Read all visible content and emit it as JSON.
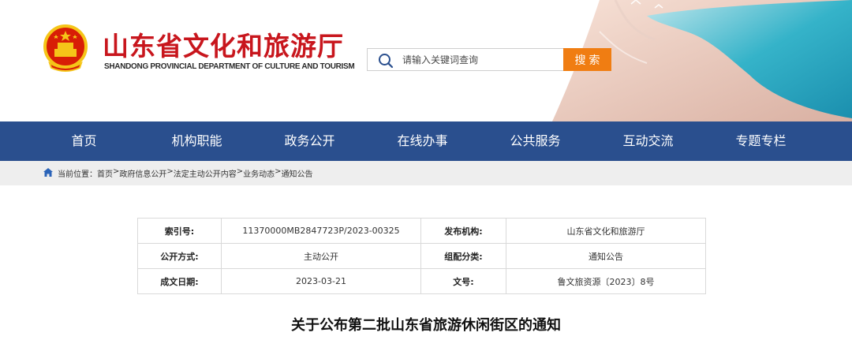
{
  "header": {
    "title": "山东省文化和旅游厅",
    "subtitle": "SHANDONG PROVINCIAL DEPARTMENT OF CULTURE AND TOURISM",
    "emblem_icon": "national-emblem-icon"
  },
  "search": {
    "placeholder": "请输入关键词查询",
    "button_label": "搜索",
    "button_color": "#f07d12"
  },
  "nav": {
    "background": "#2a4f8e",
    "items": [
      {
        "label": "首页"
      },
      {
        "label": "机构职能"
      },
      {
        "label": "政务公开"
      },
      {
        "label": "在线办事"
      },
      {
        "label": "公共服务"
      },
      {
        "label": "互动交流"
      },
      {
        "label": "专题专栏"
      }
    ]
  },
  "breadcrumb": {
    "prefix": "当前位置：",
    "items": [
      "首页",
      "政府信息公开",
      "法定主动公开内容",
      "业务动态",
      "通知公告"
    ],
    "separator": ">"
  },
  "meta": {
    "rows": [
      {
        "k1": "索引号:",
        "v1": "11370000MB2847723P/2023-00325",
        "k2": "发布机构:",
        "v2": "山东省文化和旅游厅"
      },
      {
        "k1": "公开方式:",
        "v1": "主动公开",
        "k2": "组配分类:",
        "v2": "通知公告"
      },
      {
        "k1": "成文日期:",
        "v1": "2023-03-21",
        "k2": "文号:",
        "v2": "鲁文旅资源〔2023〕8号"
      }
    ]
  },
  "document": {
    "title": "关于公布第二批山东省旅游休闲街区的通知"
  }
}
